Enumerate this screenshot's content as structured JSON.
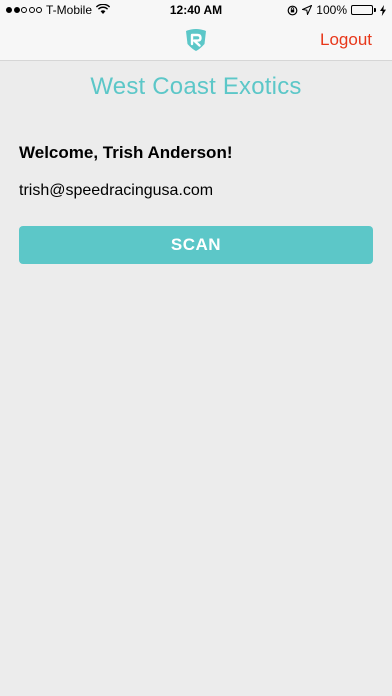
{
  "status_bar": {
    "carrier": "T-Mobile",
    "time": "12:40 AM",
    "battery_percent": "100%",
    "signal_bars_filled": 2,
    "signal_bars_total": 5
  },
  "nav": {
    "logo_icon": "shield-r-logo-icon",
    "logout_label": "Logout"
  },
  "main": {
    "title": "West Coast Exotics",
    "welcome": "Welcome, Trish Anderson!",
    "email": "trish@speedracingusa.com",
    "scan_label": "SCAN"
  },
  "colors": {
    "accent": "#5cc7c8",
    "logout": "#e8371a",
    "background": "#ececec"
  }
}
